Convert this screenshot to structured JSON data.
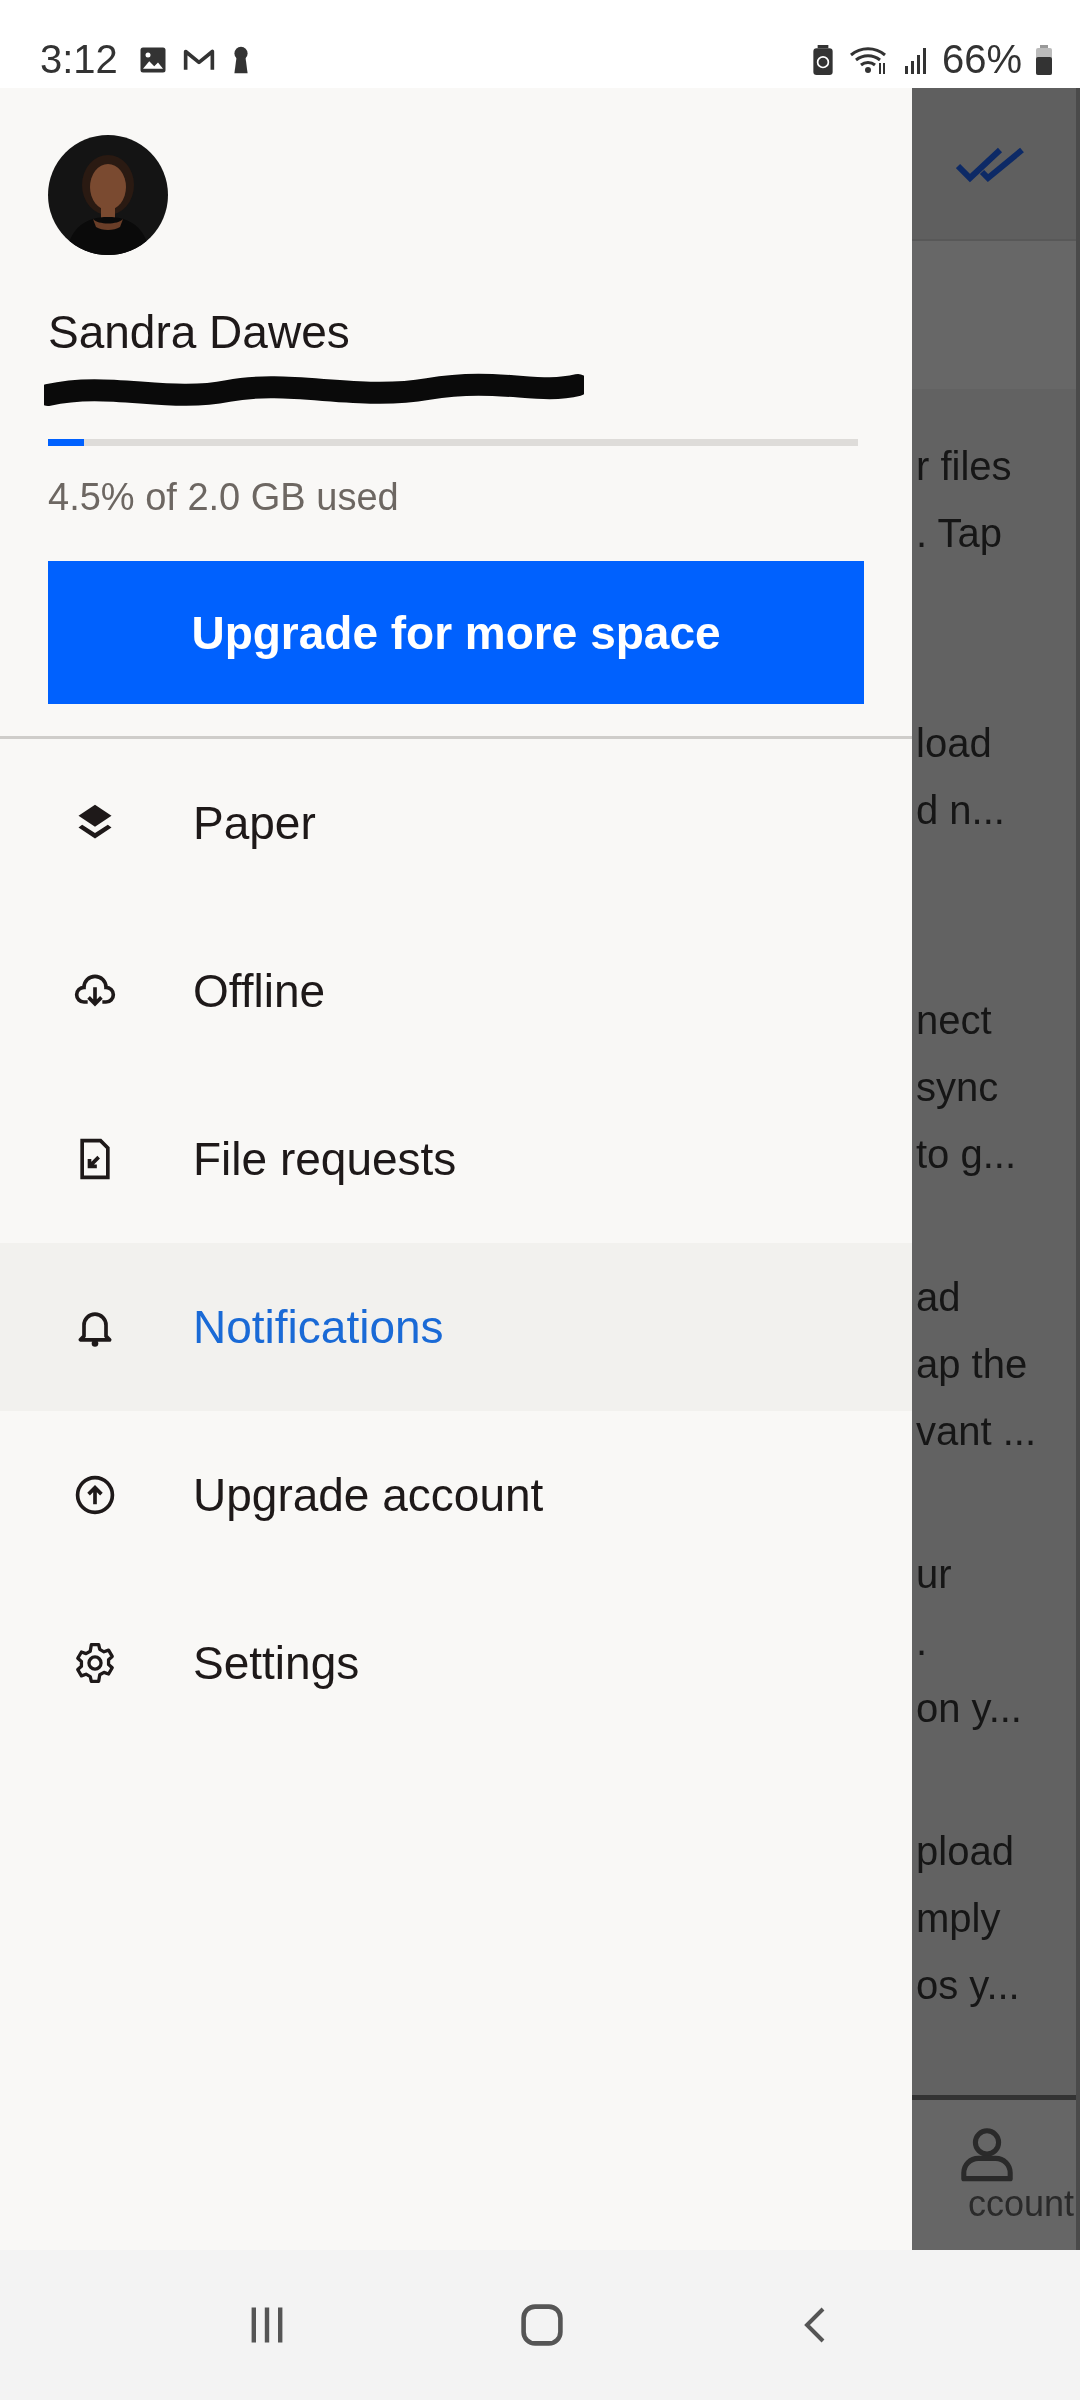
{
  "status_bar": {
    "time": "3:12",
    "battery": "66%"
  },
  "drawer": {
    "user": {
      "name": "Sandra Dawes"
    },
    "storage": {
      "level": 0.045,
      "usage": "4.5% of 2.0 GB used"
    },
    "upgrade_button": "Upgrade for more space",
    "menu": [
      {
        "label": "Paper",
        "selected": false
      },
      {
        "label": "Offline",
        "selected": false
      },
      {
        "label": "File requests",
        "selected": false
      },
      {
        "label": "Notifications",
        "selected": true
      },
      {
        "label": "Upgrade account",
        "selected": false
      },
      {
        "label": "Settings",
        "selected": false
      }
    ]
  },
  "background": {
    "cards": [
      {
        "lines": [
          "r files",
          ". Tap"
        ]
      },
      {
        "lines": [
          "load",
          "d n..."
        ]
      },
      {
        "lines": [
          "nect",
          "sync",
          "to g..."
        ]
      },
      {
        "lines": [
          "ad",
          "ap the",
          "vant ..."
        ]
      },
      {
        "lines": [
          "ur",
          ".",
          "on y..."
        ]
      },
      {
        "lines": [
          "pload",
          "mply",
          "os y..."
        ]
      }
    ],
    "tab": "ccount"
  }
}
